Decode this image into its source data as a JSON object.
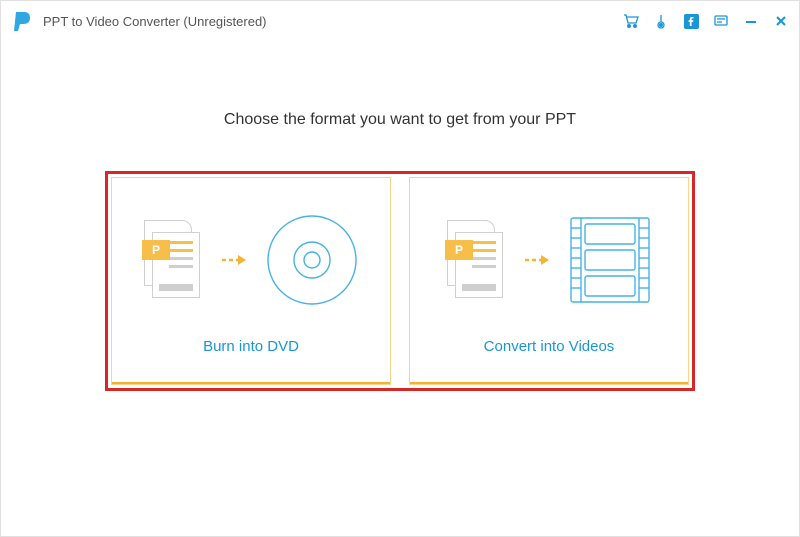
{
  "titlebar": {
    "app_title": "PPT to Video Converter (Unregistered)"
  },
  "content": {
    "headline": "Choose the format you want to get from your PPT",
    "options": {
      "dvd": {
        "label": "Burn into DVD"
      },
      "video": {
        "label": "Convert into Videos"
      }
    }
  },
  "icons": {
    "ppt_tag": "P"
  },
  "colors": {
    "accent_blue": "#1996d6",
    "accent_orange": "#f3b531",
    "highlight_red": "#d62828"
  }
}
